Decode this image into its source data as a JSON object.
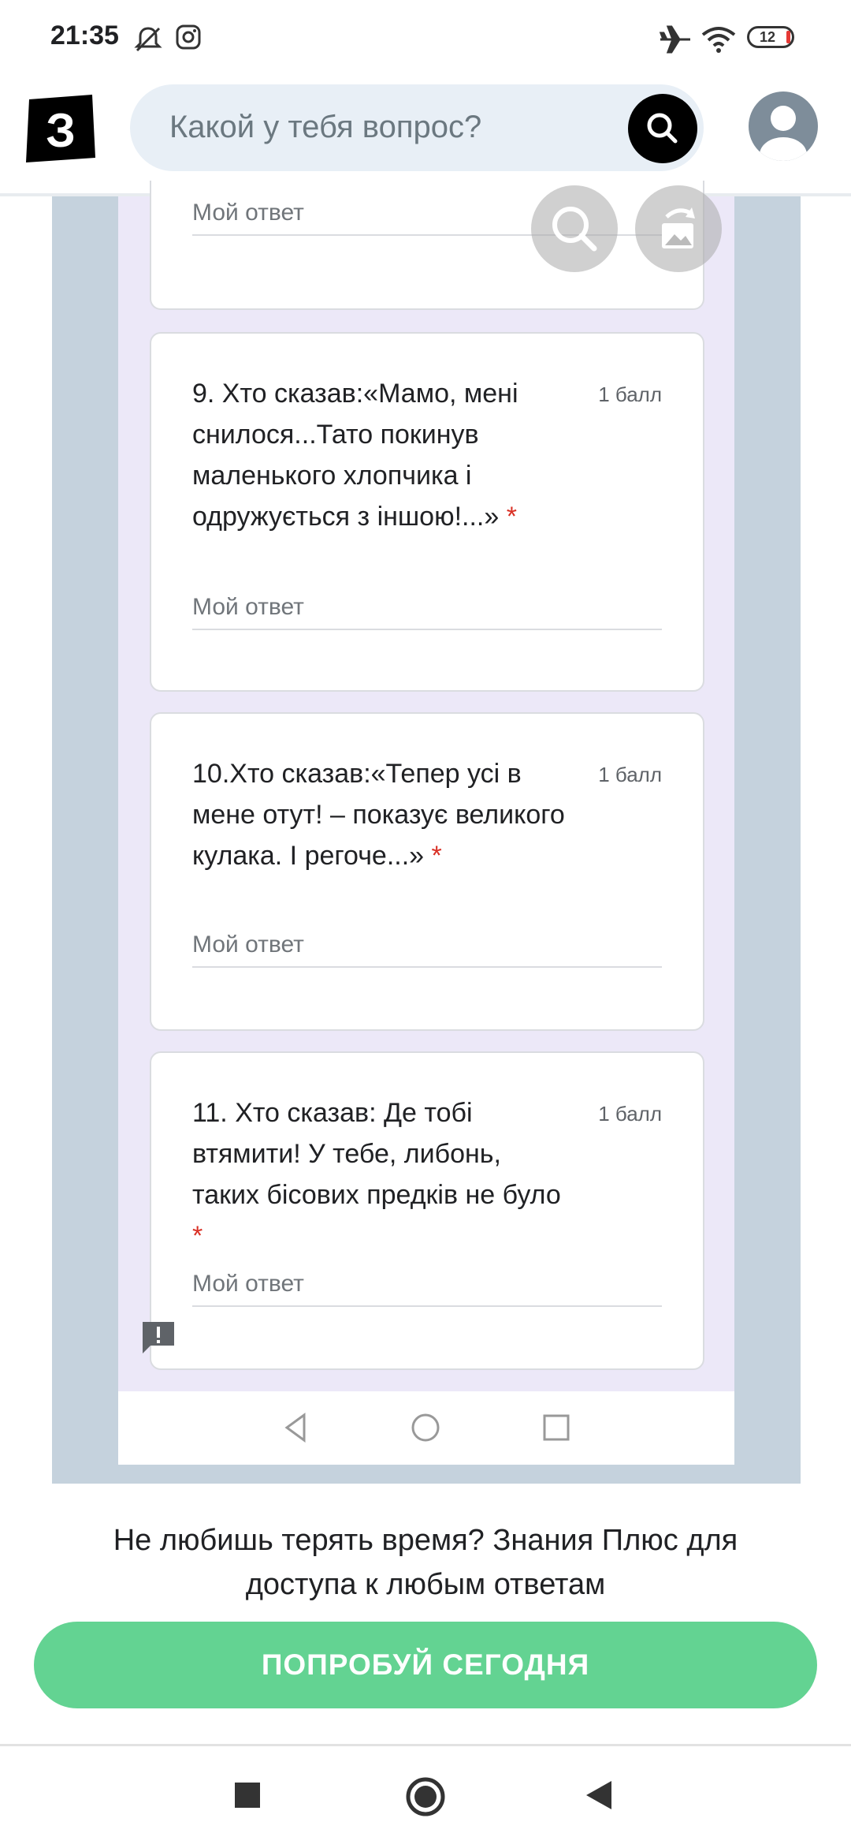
{
  "status_bar": {
    "time": "21:35",
    "battery": "12"
  },
  "header": {
    "search_placeholder": "Какой у тебя вопрос?"
  },
  "form": {
    "answer_label_top": "Мой ответ",
    "questions": [
      {
        "text": "9. Хто сказав:«Мамо, мені снилося...Тато покинув маленького хлопчика і одружується з іншою!...»",
        "points": "1 балл",
        "required_mark": "*",
        "answer_placeholder": "Мой ответ"
      },
      {
        "text": "10.Хто сказав:«Тепер усі в мене отут! – показує великого кулака. І регоче...»",
        "points": "1 балл",
        "required_mark": "*",
        "answer_placeholder": "Мой ответ"
      },
      {
        "text": "11. Хто сказав: Де тобі втямити! У тебе, либонь, таких бісових предків не було",
        "points": "1 балл",
        "required_mark": "*",
        "answer_placeholder": "Мой ответ"
      }
    ]
  },
  "promo": {
    "text": "Не любишь терять время? Знания Плюс для доступа к любым ответам",
    "button": "ПОПРОБУЙ СЕГОДНЯ"
  },
  "colors": {
    "accent_green": "#63d392",
    "required_red": "#d93025",
    "search_bg": "#e8eff6"
  }
}
